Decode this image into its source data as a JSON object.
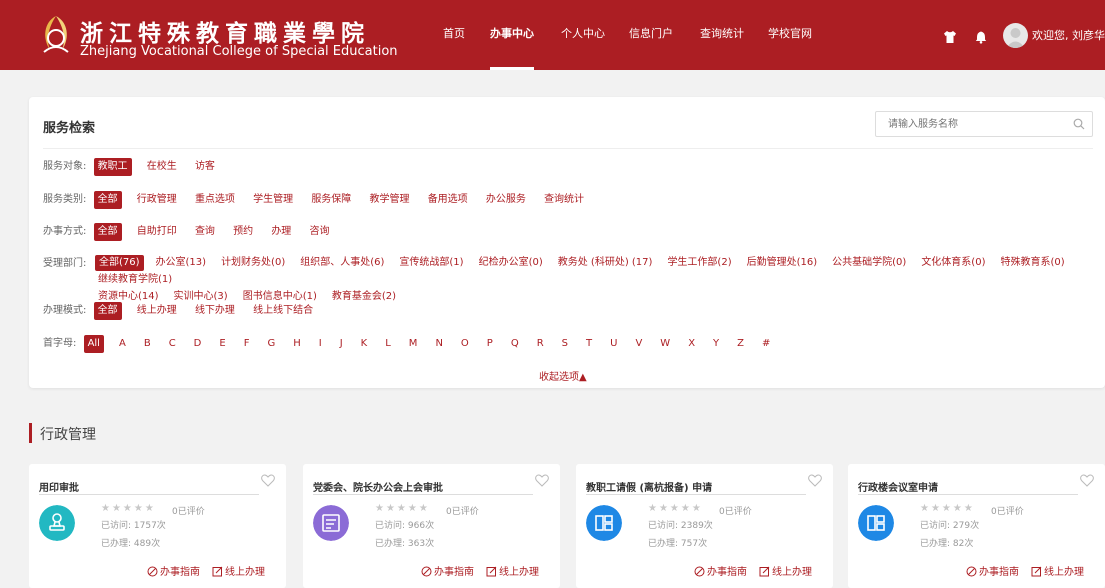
{
  "header": {
    "college_cn": "浙江特殊教育職業學院",
    "college_en": "Zhejiang Vocational College of Special Education",
    "nav": [
      "首页",
      "办事中心",
      "个人中心",
      "信息门户",
      "查询统计",
      "学校官网"
    ],
    "active_nav": "办事中心",
    "welcome": "欢迎您, 刘彦华",
    "accent": "#ac1e23"
  },
  "search": {
    "title": "服务检索",
    "placeholder": "请输入服务名称",
    "collapse": "收起选项▲",
    "filters": {
      "target": {
        "label": "服务对象:",
        "options": [
          "教职工",
          "在校生",
          "访客"
        ]
      },
      "category": {
        "label": "服务类别:",
        "options": [
          "全部",
          "行政管理",
          "重点选项",
          "学生管理",
          "服务保障",
          "教学管理",
          "备用选项",
          "办公服务",
          "查询统计"
        ]
      },
      "method": {
        "label": "办事方式:",
        "options": [
          "全部",
          "自助打印",
          "查询",
          "预约",
          "办理",
          "咨询"
        ]
      },
      "dept": {
        "label": "受理部门:",
        "options": [
          "全部(76)",
          "办公室(13)",
          "计划财务处(0)",
          "组织部、人事处(6)",
          "宣传统战部(1)",
          "纪检办公室(0)",
          "教务处 (科研处) (17)",
          "学生工作部(2)",
          "后勤管理处(16)",
          "公共基础学院(0)",
          "文化体育系(0)",
          "特殊教育系(0)",
          "继续教育学院(1)",
          "资源中心(14)",
          "实训中心(3)",
          "图书信息中心(1)",
          "教育基金会(2)"
        ]
      },
      "mode": {
        "label": "办理模式:",
        "options": [
          "全部",
          "线上办理",
          "线下办理",
          "线上线下结合"
        ]
      },
      "letter": {
        "label": "首字母:",
        "options": [
          "All",
          "A",
          "B",
          "C",
          "D",
          "E",
          "F",
          "G",
          "H",
          "I",
          "J",
          "K",
          "L",
          "M",
          "N",
          "O",
          "P",
          "Q",
          "R",
          "S",
          "T",
          "U",
          "V",
          "W",
          "X",
          "Y",
          "Z",
          "#"
        ]
      }
    }
  },
  "section": {
    "title": "行政管理"
  },
  "cards": [
    {
      "title": "用印审批",
      "stars": "★★★★★",
      "rating": "0已评价",
      "visits": "已访问: 1757次",
      "done": "已办理: 489次",
      "guide": "办事指南",
      "online": "线上办理",
      "color": "#22b8c2",
      "icon": "stamp-icon"
    },
    {
      "title": "党委会、院长办公会上会审批",
      "stars": "★★★★★",
      "rating": "0已评价",
      "visits": "已访问: 966次",
      "done": "已办理: 363次",
      "guide": "办事指南",
      "online": "线上办理",
      "color": "#8b6bd6",
      "icon": "meeting-icon"
    },
    {
      "title": "教职工请假 (离杭报备) 申请",
      "stars": "★★★★★",
      "rating": "0已评价",
      "visits": "已访问: 2389次",
      "done": "已办理: 757次",
      "guide": "办事指南",
      "online": "线上办理",
      "color": "#1e88e5",
      "icon": "document-icon"
    },
    {
      "title": "行政楼会议室申请",
      "stars": "★★★★★",
      "rating": "0已评价",
      "visits": "已访问: 279次",
      "done": "已办理: 82次",
      "guide": "办事指南",
      "online": "线上办理",
      "color": "#1e88e5",
      "icon": "room-icon"
    }
  ]
}
